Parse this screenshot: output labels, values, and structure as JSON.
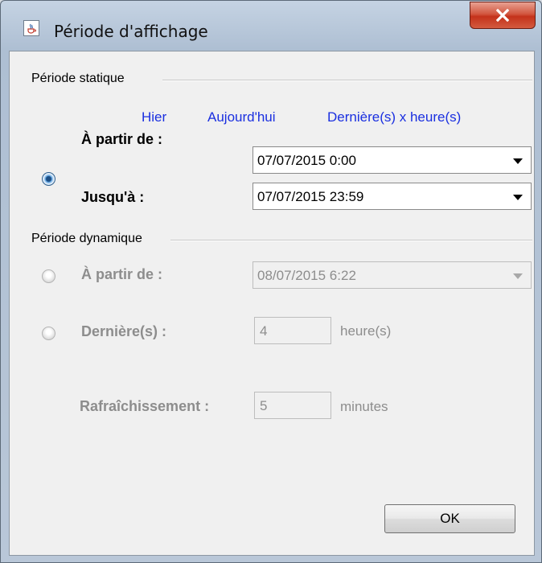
{
  "window": {
    "title": "Période d'affichage",
    "icon": "java-cup-icon",
    "close_icon": "close-x-icon"
  },
  "static_section": {
    "label": "Période statique",
    "links": [
      "Hier",
      "Aujourd'hui",
      "Dernière(s) x heure(s)"
    ],
    "radio_selected": true,
    "from_label": "À partir de :",
    "from_value": "07/07/2015 0:00",
    "to_label": "Jusqu'à :",
    "to_value": "07/07/2015 23:59"
  },
  "dynamic_section": {
    "label": "Période dynamique",
    "from_label": "À partir de :",
    "from_value": "08/07/2015 6:22",
    "last_label": "Dernière(s) :",
    "last_value": "4",
    "last_unit": "heure(s)",
    "refresh_label": "Rafraîchissement :",
    "refresh_value": "5",
    "refresh_unit": "minutes"
  },
  "buttons": {
    "ok": "OK"
  },
  "colors": {
    "link": "#1a2fe0",
    "disabled_text": "#8d8d8d",
    "close_button": "#c4321b"
  }
}
